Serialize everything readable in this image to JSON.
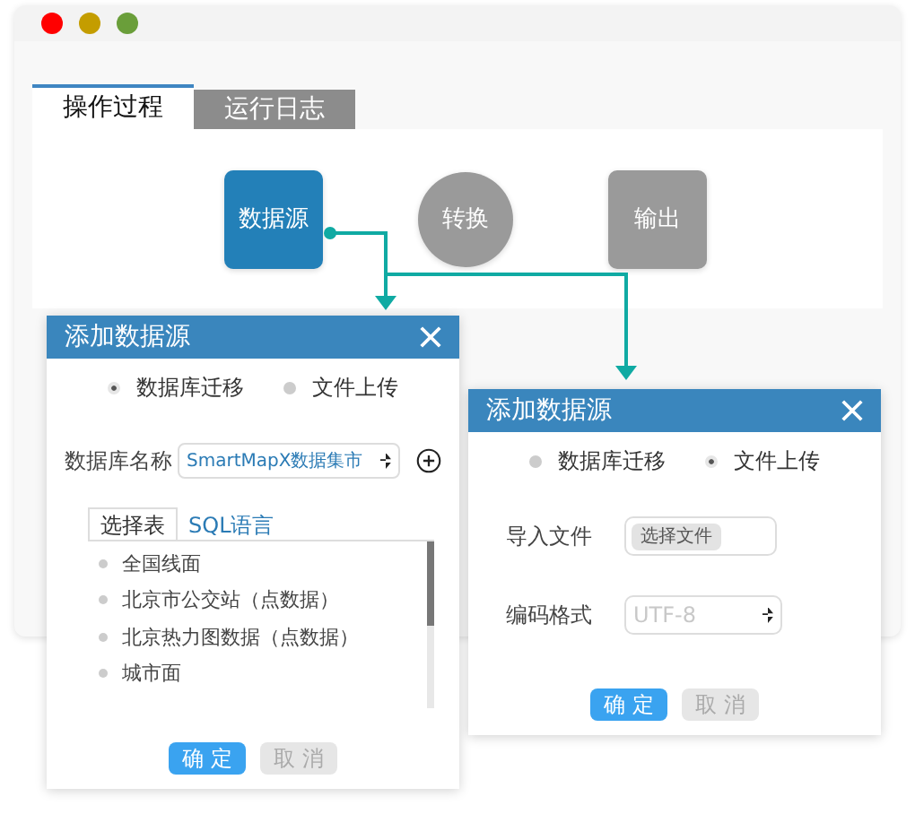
{
  "tabs": [
    {
      "label": "操作过程",
      "selected": true
    },
    {
      "label": "运行日志",
      "selected": false
    }
  ],
  "flow": {
    "nodes": [
      {
        "label": "数据源",
        "kind": "square",
        "active": true
      },
      {
        "label": "转换",
        "kind": "circle",
        "active": false
      },
      {
        "label": "输出",
        "kind": "square",
        "active": false
      }
    ]
  },
  "dialogs": [
    {
      "title": "添加数据源",
      "kind": "database",
      "modes": [
        {
          "label": "数据库迁移",
          "selected": true
        },
        {
          "label": "文件上传",
          "selected": false
        }
      ],
      "database": {
        "label": "数据库名称",
        "value": "SmartMapX数据集市"
      },
      "source_tabs": [
        {
          "label": "选择表",
          "selected": true
        },
        {
          "label": "SQL语言",
          "selected": false
        }
      ],
      "tables": [
        "全国线面",
        "北京市公交站（点数据）",
        "北京热力图数据（点数据）",
        "城市面"
      ],
      "buttons": [
        {
          "label": "确 定",
          "disabled": false
        },
        {
          "label": "取 消",
          "disabled": true
        }
      ]
    },
    {
      "title": "添加数据源",
      "kind": "file",
      "modes": [
        {
          "label": "数据库迁移",
          "selected": false
        },
        {
          "label": "文件上传",
          "selected": true
        }
      ],
      "file": {
        "label": "导入文件",
        "button": "选择文件"
      },
      "encoding": {
        "label": "编码格式",
        "value": "UTF-8",
        "disabled": true
      },
      "buttons": [
        {
          "label": "确 定",
          "disabled": false
        },
        {
          "label": "取 消",
          "disabled": true
        }
      ]
    }
  ]
}
